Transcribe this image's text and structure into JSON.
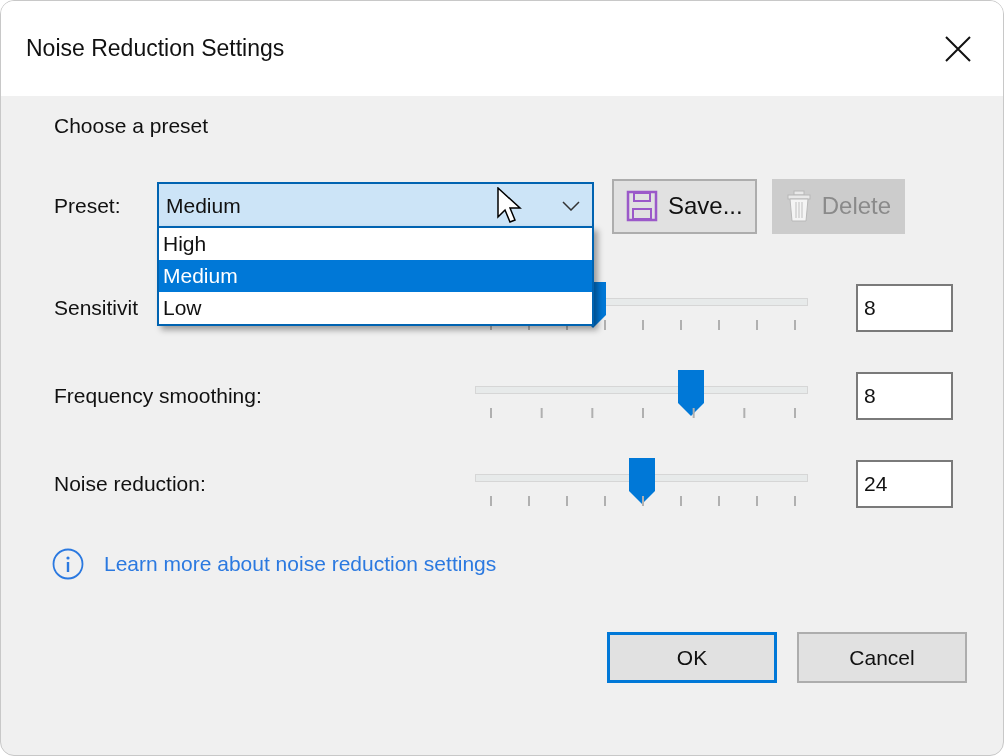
{
  "window": {
    "title": "Noise Reduction Settings"
  },
  "section_heading": "Choose a preset",
  "preset": {
    "label": "Preset:",
    "value": "Medium",
    "expanded": true,
    "options": [
      {
        "label": "High",
        "selected": false
      },
      {
        "label": "Medium",
        "selected": true
      },
      {
        "label": "Low",
        "selected": false
      }
    ]
  },
  "preset_buttons": [
    {
      "label": "Save...",
      "kind": "save",
      "disabled": false
    },
    {
      "label": "Delete",
      "kind": "delete",
      "disabled": true
    }
  ],
  "sliders": [
    {
      "label": "Sensitivit",
      "kind": "dense",
      "level": 0.34,
      "value": "8"
    },
    {
      "label": "Frequency smoothing:",
      "kind": "sparse",
      "level": 0.66,
      "value": "8"
    },
    {
      "label": "Noise reduction:",
      "kind": "dense",
      "level": 0.5,
      "value": "24"
    }
  ],
  "link": "Learn more about noise reduction settings",
  "footer_buttons": [
    {
      "label": "OK",
      "default": true
    },
    {
      "label": "Cancel",
      "default": false
    }
  ]
}
